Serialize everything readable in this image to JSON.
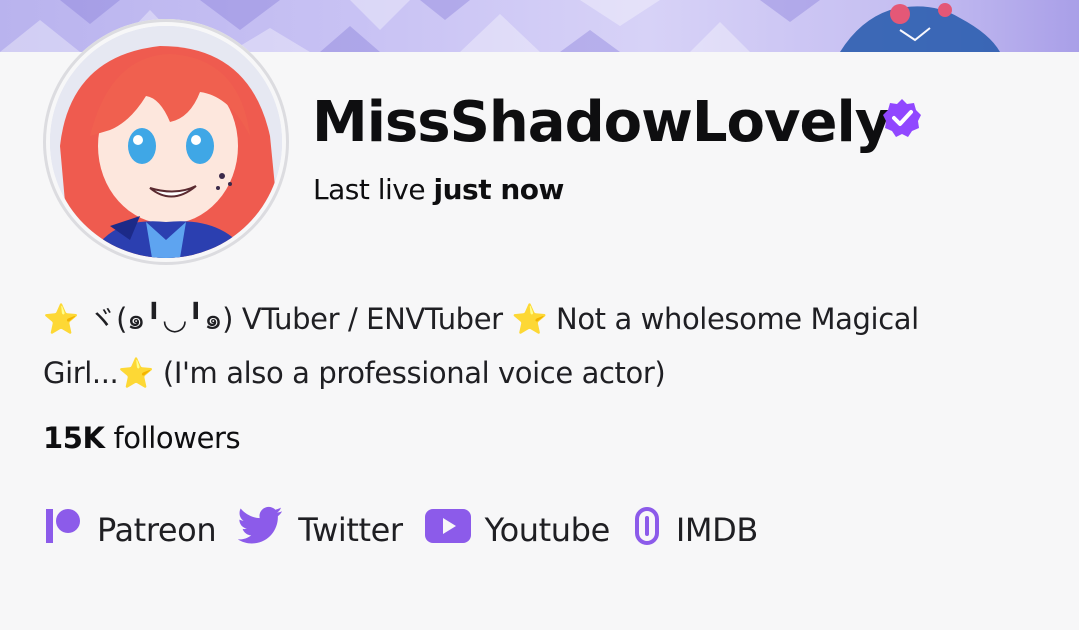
{
  "profile": {
    "channel_name": "MissShadowLovely",
    "last_live_prefix": "Last live",
    "last_live_value": "just now",
    "bio_line1_a": "ヾ(๑╹◡╹๑) VTuber / ENVTuber",
    "bio_line1_b": "Not a wholesome Magical",
    "bio_line2_a": "Girl...",
    "bio_line2_b": "(I'm also a professional voice actor)",
    "star_glyph": "⭐",
    "followers_count": "15K",
    "followers_label": "followers"
  },
  "links": [
    {
      "label": "Patreon",
      "icon": "patreon-icon"
    },
    {
      "label": "Twitter",
      "icon": "twitter-icon"
    },
    {
      "label": "Youtube",
      "icon": "youtube-icon"
    },
    {
      "label": "IMDB",
      "icon": "link-icon"
    }
  ],
  "colors": {
    "accent": "#9147ff",
    "icon": "#8c5bea",
    "text": "#0e0e10",
    "star": "#f5c518",
    "background": "#f7f7f8"
  }
}
